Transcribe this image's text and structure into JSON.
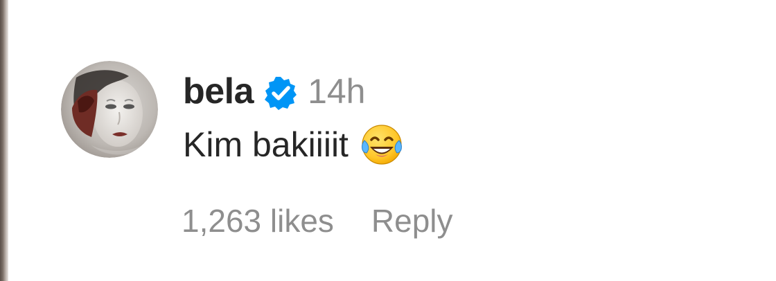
{
  "comment": {
    "username": "bela",
    "timestamp": "14h",
    "text": "Kim bakiiiit",
    "emoji": "face-with-tears-of-joy",
    "likes": "1,263 likes",
    "reply_label": "Reply"
  },
  "colors": {
    "primary_text": "#262626",
    "secondary_text": "#8e8e8e",
    "verified_badge": "#0095f6",
    "background": "#ffffff"
  },
  "icons": {
    "verified": "verified-badge-icon",
    "emoji": "tears-of-joy-emoji-icon"
  }
}
